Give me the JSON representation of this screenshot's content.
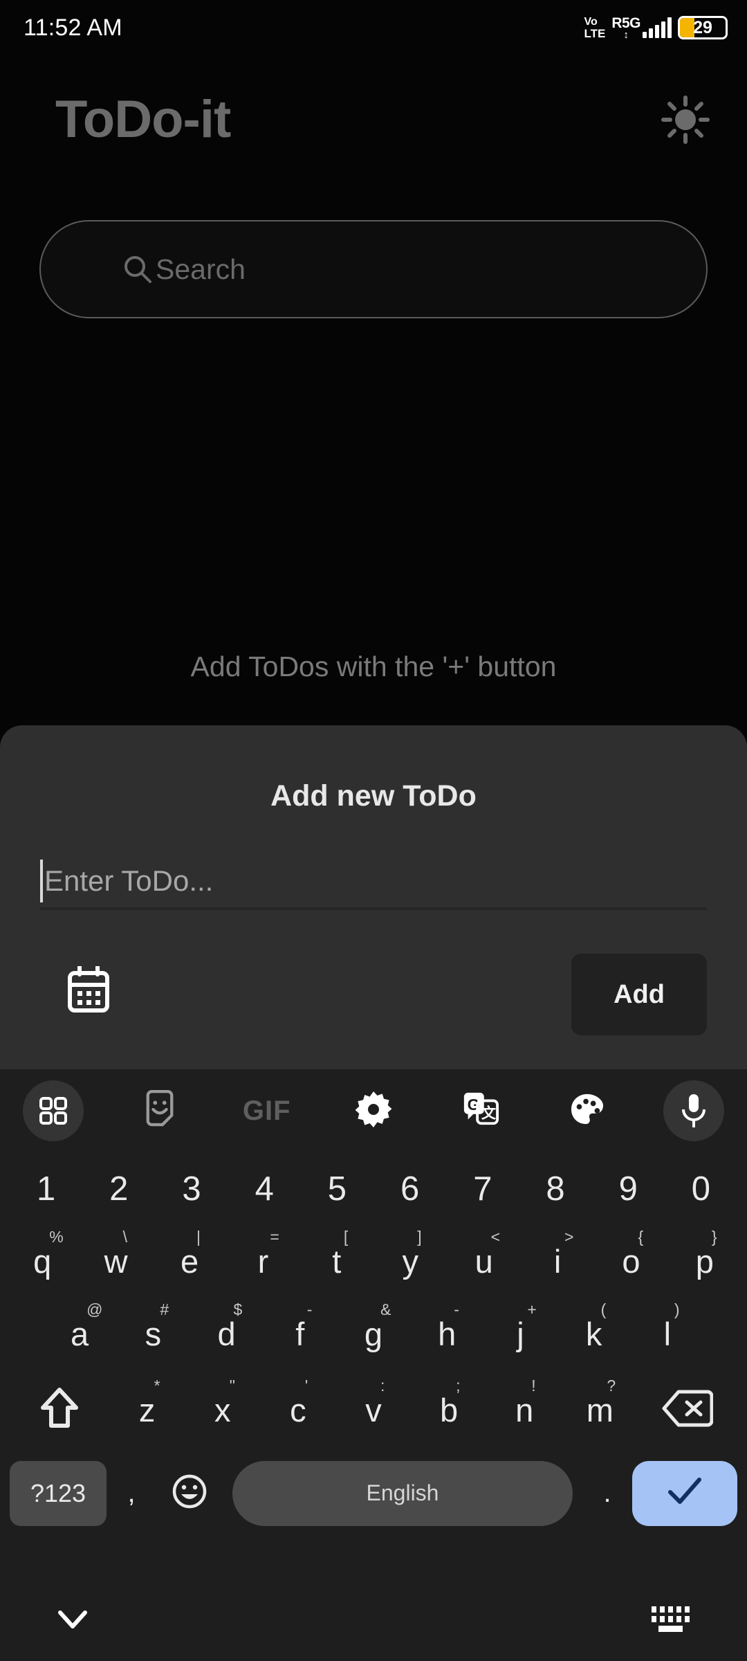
{
  "status_bar": {
    "time": "11:52 AM",
    "volte_top": "Vo",
    "volte_bottom": "LTE",
    "network": "R5G",
    "data_arrows": "↕",
    "battery_level": "29",
    "battery_color": "#f5b400",
    "signal_bars": 5
  },
  "header": {
    "title": "ToDo-it",
    "title_color": "#6b6b6b",
    "theme_icon": "sun-icon"
  },
  "search": {
    "placeholder": "Search",
    "icon": "search-icon"
  },
  "main": {
    "empty_message": "Add ToDos with the '+' button"
  },
  "dialog": {
    "title": "Add new ToDo",
    "input_placeholder": "Enter ToDo...",
    "input_value": "",
    "date_icon": "calendar-icon",
    "add_label": "Add",
    "background": "#2f2f2f"
  },
  "keyboard": {
    "background": "#1e1e1e",
    "toolbar": [
      {
        "name": "apps-grid-icon",
        "label": ""
      },
      {
        "name": "sticker-icon",
        "label": ""
      },
      {
        "name": "gif-icon",
        "label": "GIF"
      },
      {
        "name": "gear-icon",
        "label": ""
      },
      {
        "name": "translate-icon",
        "label": ""
      },
      {
        "name": "palette-icon",
        "label": ""
      },
      {
        "name": "microphone-icon",
        "label": ""
      }
    ],
    "number_row": [
      "1",
      "2",
      "3",
      "4",
      "5",
      "6",
      "7",
      "8",
      "9",
      "0"
    ],
    "row_top": [
      {
        "key": "q",
        "sup": "%"
      },
      {
        "key": "w",
        "sup": "\\"
      },
      {
        "key": "e",
        "sup": "|"
      },
      {
        "key": "r",
        "sup": "="
      },
      {
        "key": "t",
        "sup": "["
      },
      {
        "key": "y",
        "sup": "]"
      },
      {
        "key": "u",
        "sup": "<"
      },
      {
        "key": "i",
        "sup": ">"
      },
      {
        "key": "o",
        "sup": "{"
      },
      {
        "key": "p",
        "sup": "}"
      }
    ],
    "row_mid": [
      {
        "key": "a",
        "sup": "@"
      },
      {
        "key": "s",
        "sup": "#"
      },
      {
        "key": "d",
        "sup": "$"
      },
      {
        "key": "f",
        "sup": "-"
      },
      {
        "key": "g",
        "sup": "&"
      },
      {
        "key": "h",
        "sup": "-"
      },
      {
        "key": "j",
        "sup": "+"
      },
      {
        "key": "k",
        "sup": "("
      },
      {
        "key": "l",
        "sup": ")"
      }
    ],
    "row_bottom": [
      {
        "key": "z",
        "sup": "*"
      },
      {
        "key": "x",
        "sup": "\""
      },
      {
        "key": "c",
        "sup": "'"
      },
      {
        "key": "v",
        "sup": ":"
      },
      {
        "key": "b",
        "sup": ";"
      },
      {
        "key": "n",
        "sup": "!"
      },
      {
        "key": "m",
        "sup": "?"
      }
    ],
    "shift_icon": "shift-icon",
    "backspace_icon": "backspace-icon",
    "symbols_label": "?123",
    "comma_label": ",",
    "emoji_icon": "emoji-icon",
    "space_label": "English",
    "period_label": ".",
    "enter_icon": "checkmark-icon",
    "enter_color": "#a5c3f5"
  },
  "navbar": {
    "hide_keyboard_icon": "chevron-down-icon",
    "switch_keyboard_icon": "keyboard-icon"
  }
}
